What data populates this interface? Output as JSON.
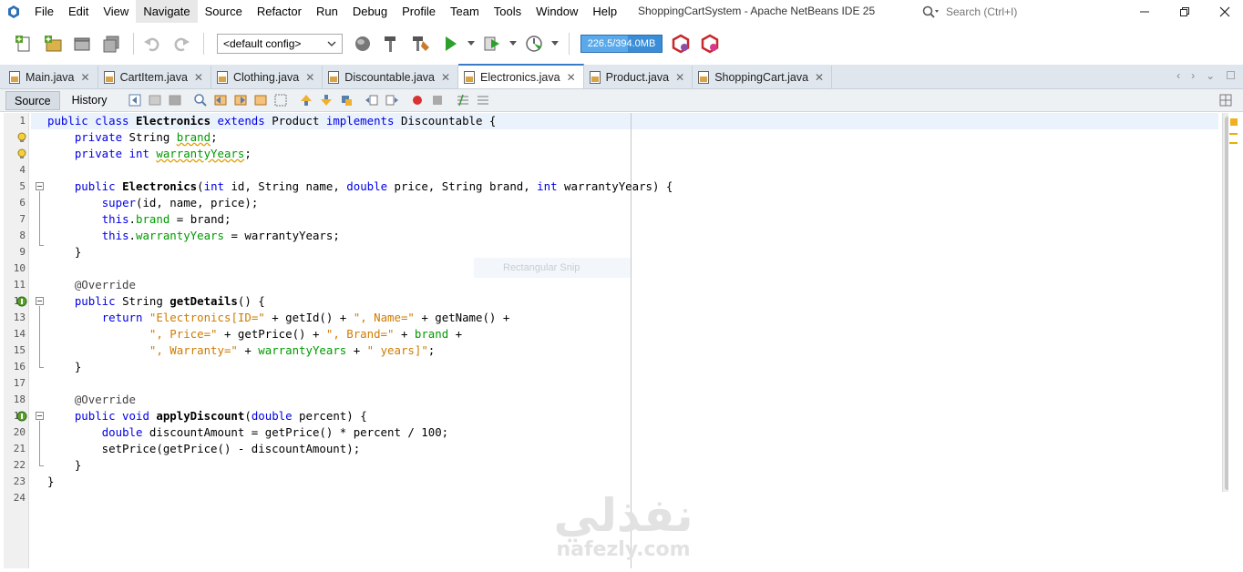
{
  "menu": [
    "File",
    "Edit",
    "View",
    "Navigate",
    "Source",
    "Refactor",
    "Run",
    "Debug",
    "Profile",
    "Team",
    "Tools",
    "Window",
    "Help"
  ],
  "window_title": "ShoppingCartSystem - Apache NetBeans IDE 25",
  "search": {
    "placeholder": "Search (Ctrl+I)"
  },
  "toolbar": {
    "config": "<default config>",
    "memory": "226.5/394.0MB",
    "memory_used_fraction": 0.575
  },
  "tabs": [
    {
      "label": "Main.java"
    },
    {
      "label": "CartItem.java"
    },
    {
      "label": "Clothing.java"
    },
    {
      "label": "Discountable.java"
    },
    {
      "label": "Electronics.java"
    },
    {
      "label": "Product.java"
    },
    {
      "label": "ShoppingCart.java"
    }
  ],
  "editor_tabs": {
    "source": "Source",
    "history": "History"
  },
  "snip_tooltip": "Rectangular Snip",
  "watermark": {
    "arabic": "نفذلي",
    "latin": "nafezly.com"
  },
  "line_numbers": [
    "1",
    "2",
    "3",
    "4",
    "5",
    "6",
    "7",
    "8",
    "9",
    "10",
    "11",
    "12",
    "13",
    "14",
    "15",
    "16",
    "17",
    "18",
    "19",
    "20",
    "21",
    "22",
    "23",
    "24"
  ],
  "code": {
    "l1": [
      "public class ",
      "Electronics",
      " extends ",
      "Product",
      " implements ",
      "Discountable",
      " {"
    ],
    "l2": [
      "    ",
      "private",
      " String ",
      "brand",
      ";"
    ],
    "l3": [
      "    ",
      "private int",
      " ",
      "warrantyYears",
      ";"
    ],
    "l5": [
      "    ",
      "public",
      " ",
      "Electronics",
      "(",
      "int",
      " id, String name, ",
      "double",
      " price, String brand, ",
      "int",
      " warrantyYears) {"
    ],
    "l6": [
      "        ",
      "super",
      "(id, name, price);"
    ],
    "l7": [
      "        ",
      "this",
      ".",
      "brand",
      " = brand;"
    ],
    "l8": [
      "        ",
      "this",
      ".",
      "warrantyYears",
      " = warrantyYears;"
    ],
    "l9": [
      "    }"
    ],
    "l11": [
      "    @Override"
    ],
    "l12": [
      "    ",
      "public",
      " String ",
      "getDetails",
      "() {"
    ],
    "l13": [
      "        ",
      "return",
      " ",
      "\"Electronics[ID=\"",
      " + getId() + ",
      "\", Name=\"",
      " + getName() +"
    ],
    "l14": [
      "               ",
      "\", Price=\"",
      " + getPrice() + ",
      "\", Brand=\"",
      " + ",
      "brand",
      " +"
    ],
    "l15": [
      "               ",
      "\", Warranty=\"",
      " + ",
      "warrantyYears",
      " + ",
      "\" years]\"",
      ";"
    ],
    "l16": [
      "    }"
    ],
    "l18": [
      "    @Override"
    ],
    "l19": [
      "    ",
      "public void",
      " ",
      "applyDiscount",
      "(",
      "double",
      " percent) {"
    ],
    "l20": [
      "        ",
      "double",
      " discountAmount = getPrice() * percent / 100;"
    ],
    "l21": [
      "        setPrice(getPrice() - discountAmount);"
    ],
    "l22": [
      "    }"
    ],
    "l23": [
      "}"
    ]
  },
  "colors": {
    "keyword": "#0000e6",
    "string": "#ce7b00",
    "field": "#009900",
    "active_tab_border": "#3a7bc8",
    "memory_bar": "#3a8dd6"
  }
}
